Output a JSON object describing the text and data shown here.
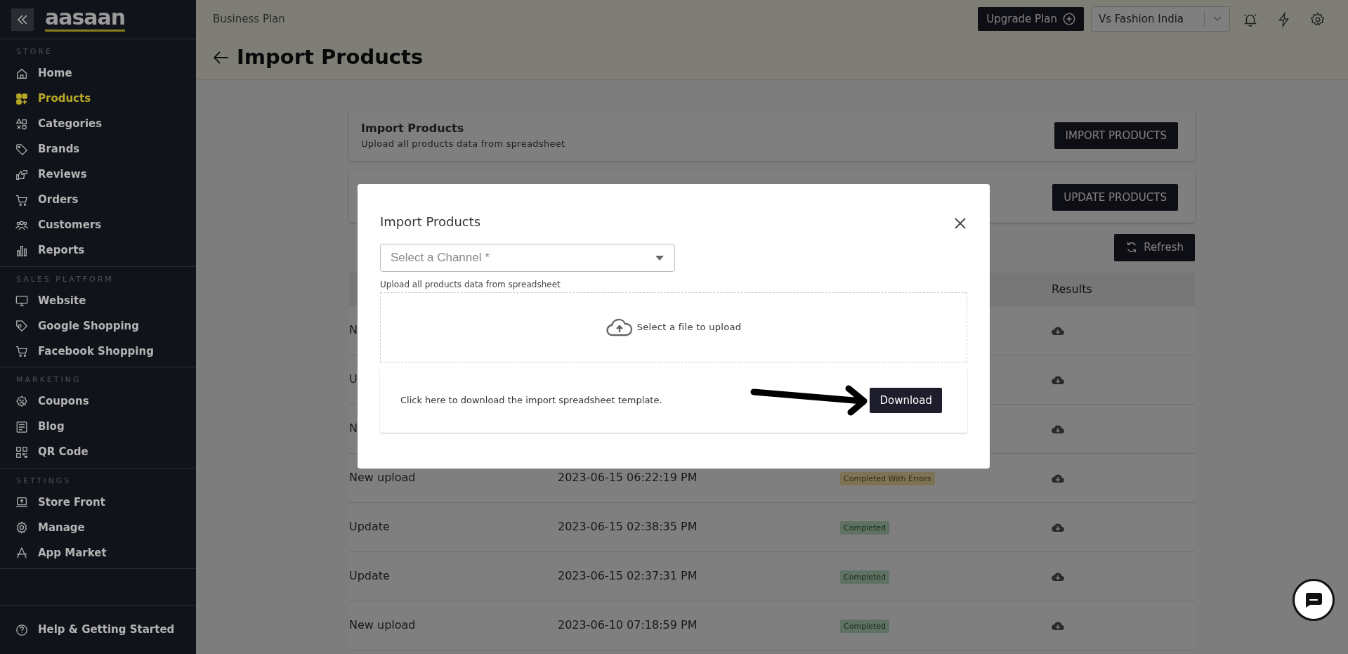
{
  "sidebar": {
    "logo": "aasaan",
    "sections": [
      {
        "title": "STORE",
        "items": [
          {
            "label": "Home",
            "selected": false
          },
          {
            "label": "Products",
            "selected": true
          },
          {
            "label": "Categories",
            "selected": false
          },
          {
            "label": "Brands",
            "selected": false
          },
          {
            "label": "Reviews",
            "selected": false
          },
          {
            "label": "Orders",
            "selected": false
          },
          {
            "label": "Customers",
            "selected": false
          },
          {
            "label": "Reports",
            "selected": false
          }
        ]
      },
      {
        "title": "SALES PLATFORM",
        "items": [
          {
            "label": "Website",
            "selected": false
          },
          {
            "label": "Google Shopping",
            "selected": false
          },
          {
            "label": "Facebook Shopping",
            "selected": false
          }
        ]
      },
      {
        "title": "MARKETING",
        "items": [
          {
            "label": "Coupons",
            "selected": false
          },
          {
            "label": "Blog",
            "selected": false
          },
          {
            "label": "QR Code",
            "selected": false
          }
        ]
      },
      {
        "title": "SETTINGS",
        "items": [
          {
            "label": "Store Front",
            "selected": false
          },
          {
            "label": "Manage",
            "selected": false
          },
          {
            "label": "App Market",
            "selected": false
          }
        ]
      }
    ],
    "help": "Help & Getting Started"
  },
  "header": {
    "plan": "Business Plan",
    "upgrade_button": "Upgrade Plan",
    "store_select": "Vs Fashion India",
    "page_title": "Import Products"
  },
  "cards": [
    {
      "title": "Import Products",
      "subtitle": "Upload all products data from spreadsheet",
      "button": "IMPORT PRODUCTS"
    },
    {
      "button": "UPDATE PRODUCTS"
    }
  ],
  "refresh_button": "Refresh",
  "table": {
    "columns": [
      {
        "label": "Results"
      }
    ],
    "rows": [
      {
        "type": "N"
      },
      {
        "type": "U"
      },
      {
        "type": "N"
      },
      {
        "type": "New upload",
        "date": "2023-06-15 06:22:19 PM",
        "status": {
          "label": "Completed With Errors",
          "kind": "warning"
        }
      },
      {
        "type": "Update",
        "date": "2023-06-15 02:38:35 PM",
        "status": {
          "label": "Completed",
          "kind": "success"
        }
      },
      {
        "type": "Update",
        "date": "2023-06-15 02:37:31 PM",
        "status": {
          "label": "Completed",
          "kind": "success"
        }
      },
      {
        "type": "New upload",
        "date": "2023-06-10 07:18:59 PM",
        "status": {
          "label": "Completed",
          "kind": "success"
        }
      }
    ]
  },
  "modal": {
    "title": "Import Products",
    "channel_select": {
      "placeholder": "Select a Channel *"
    },
    "helper": "Upload all products data from spreadsheet",
    "dropzone": "Select a file to upload",
    "template_text": "Click here to download the import spreadsheet template.",
    "download_button": "Download"
  }
}
